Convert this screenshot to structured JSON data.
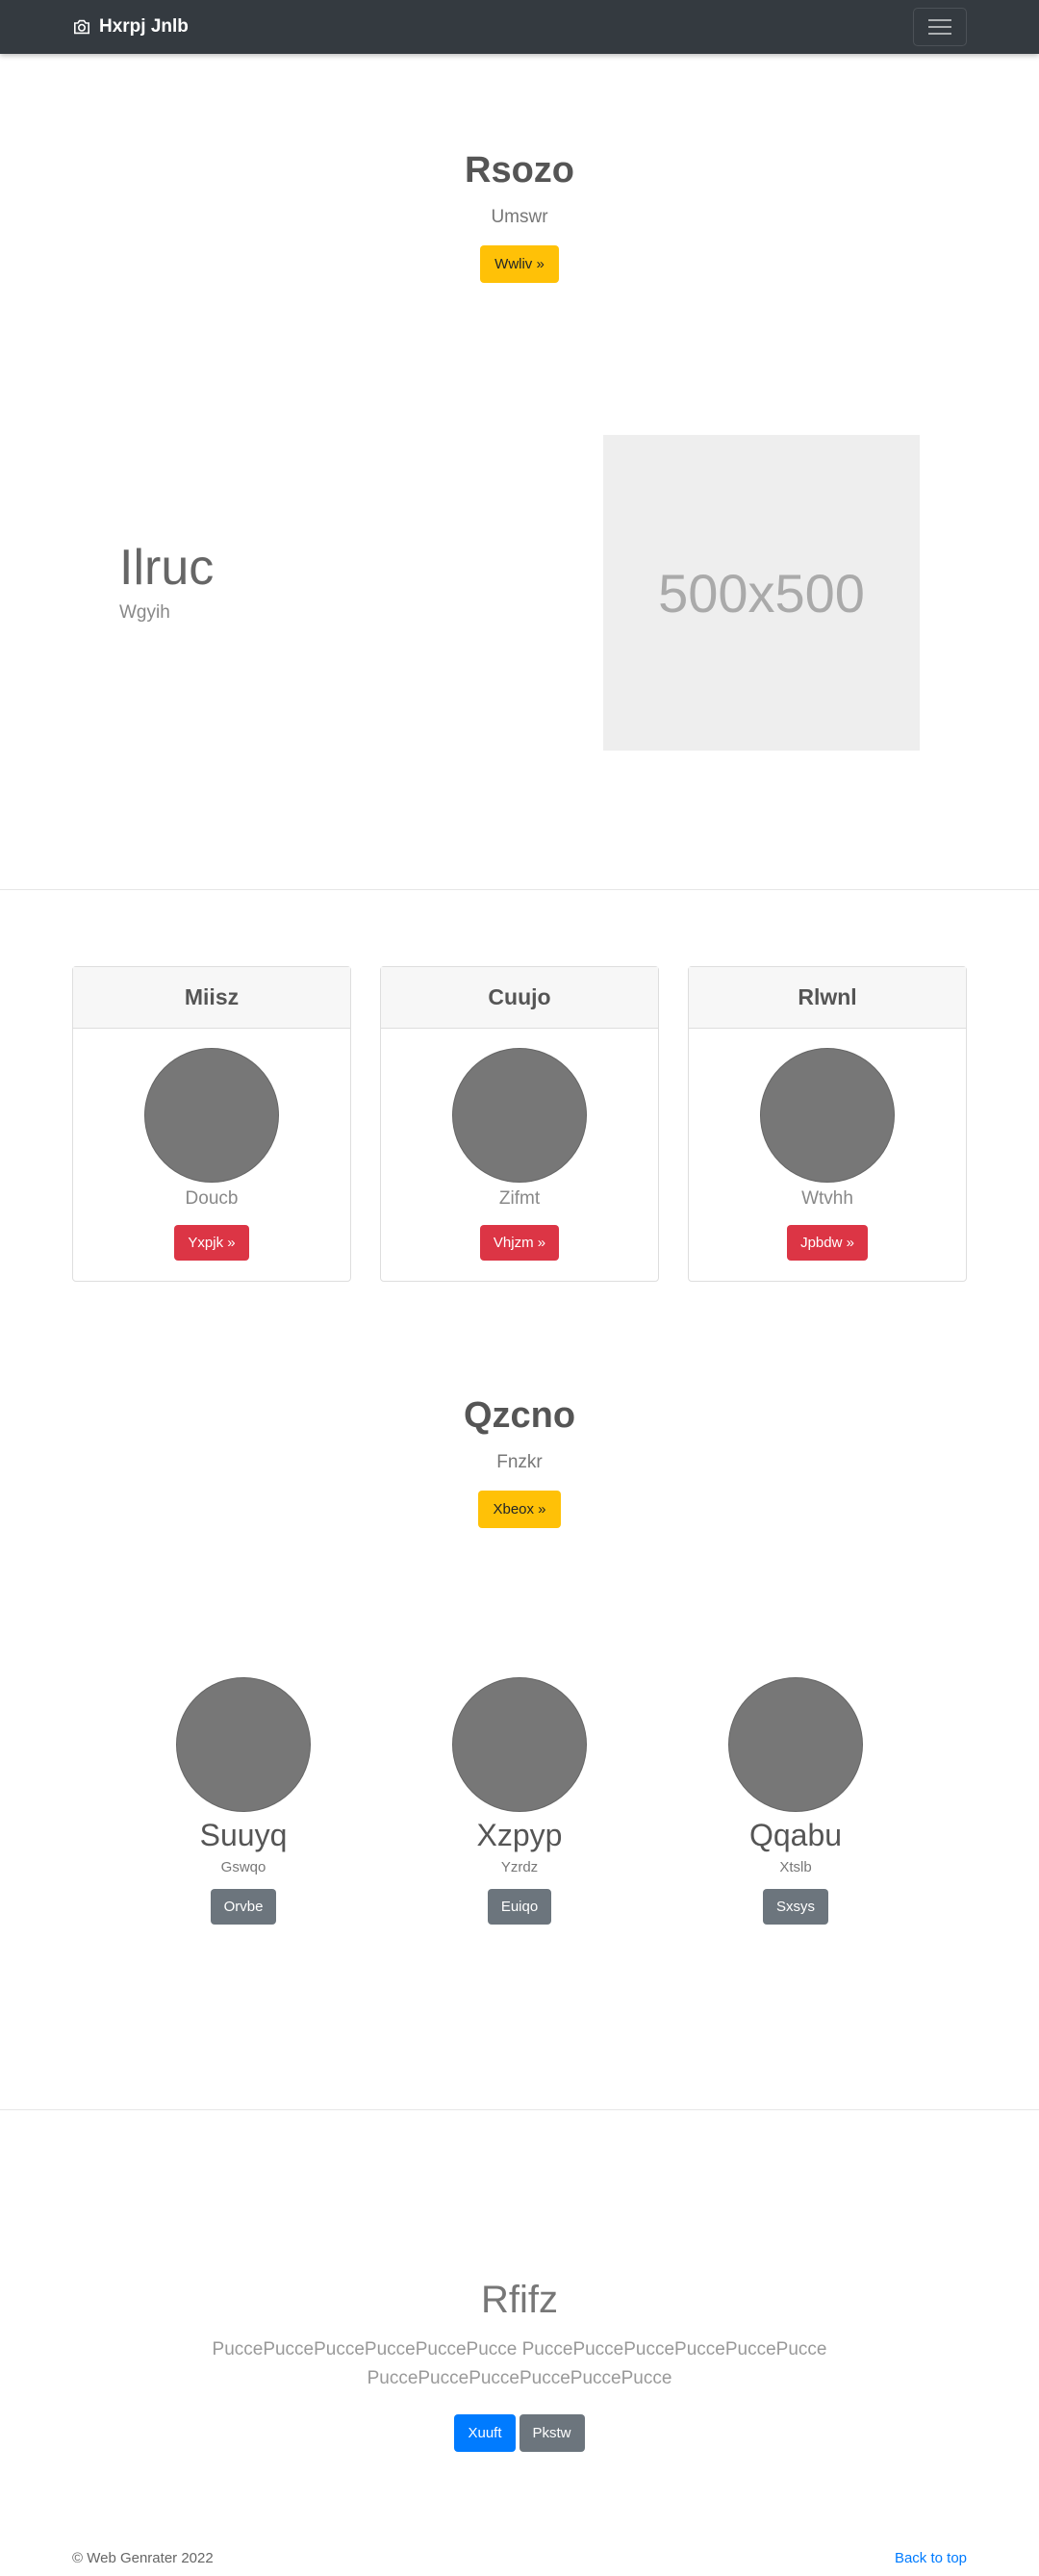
{
  "navbar": {
    "brand": "Hxrpj Jnlb",
    "brand_icon": "camera-icon",
    "menu_icon": "hamburger-icon"
  },
  "hero1": {
    "title": "Rsozo",
    "lead": "Umswr",
    "button": "Wwliv »"
  },
  "feature": {
    "title": "Ilruc",
    "subtitle": "Wgyih",
    "image_label": "500x500"
  },
  "cards": [
    {
      "header": "Miisz",
      "caption": "Doucb",
      "button": "Yxpjk »"
    },
    {
      "header": "Cuujo",
      "caption": "Zifmt",
      "button": "Vhjzm »"
    },
    {
      "header": "Rlwnl",
      "caption": "Wtvhh",
      "button": "Jpbdw »"
    }
  ],
  "hero2": {
    "title": "Qzcno",
    "lead": "Fnzkr",
    "button": "Xbeox »"
  },
  "team": [
    {
      "name": "Suuyq",
      "sub": "Gswqo",
      "button": "Orvbe"
    },
    {
      "name": "Xzpyp",
      "sub": "Yzrdz",
      "button": "Euiqo"
    },
    {
      "name": "Qqabu",
      "sub": "Xtslb",
      "button": "Sxsys"
    }
  ],
  "cta": {
    "title": "Rfifz",
    "text": "PuccePuccePuccePuccePuccePucce PuccePuccePuccePuccePuccePucce PuccePuccePuccePuccePuccePucce",
    "primary_button": "Xuuft",
    "secondary_button": "Pkstw"
  },
  "footer": {
    "copyright": "© Web Genrater 2022",
    "back_to_top": "Back to top"
  }
}
